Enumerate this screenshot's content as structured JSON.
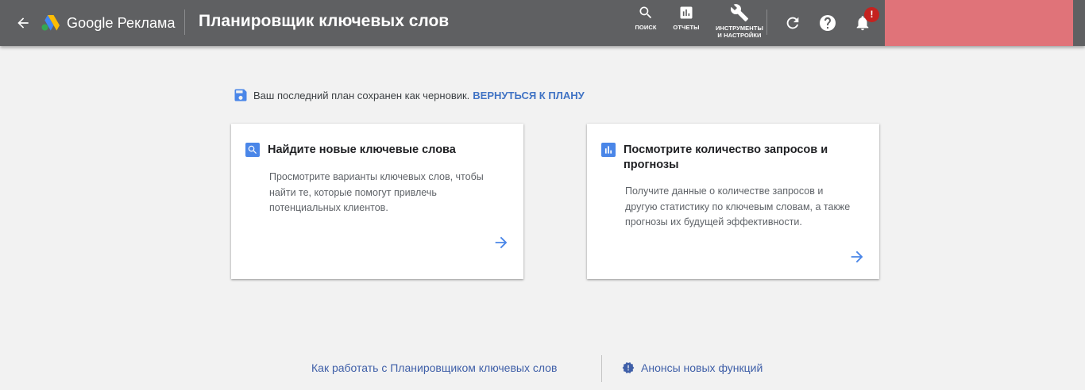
{
  "header": {
    "app_name": "Google Реклама",
    "page_title": "Планировщик ключевых слов",
    "tools": [
      {
        "label": "ПОИСК",
        "icon": "search-icon"
      },
      {
        "label": "ОТЧЕТЫ",
        "icon": "bar-chart-icon"
      },
      {
        "label_line1": "ИНСТРУМЕНТЫ",
        "label_line2": "И НАСТРОЙКИ",
        "icon": "wrench-icon"
      }
    ],
    "notification_badge": "!",
    "colors": {
      "bar": "#5f6062",
      "account_block": "#e07379",
      "badge": "#c5221f"
    }
  },
  "notice": {
    "text": "Ваш последний план сохранен как черновик.",
    "link": "ВЕРНУТЬСЯ К ПЛАНУ",
    "icon": "save-icon"
  },
  "cards": [
    {
      "title": "Найдите новые ключевые слова",
      "body_lines": [
        "Просмотрите варианты ключевых слов, чтобы",
        "найти те, которые помогут привлечь",
        "потенциальных клиентов."
      ],
      "icon": "search-icon"
    },
    {
      "title_line1": "Посмотрите количество запросов и",
      "title_line2": "прогнозы",
      "body_lines": [
        "Получите данные о количестве запросов и",
        "другую статистику по ключевым словам, а также",
        "прогнозы их будущей эффективности."
      ],
      "icon": "bar-chart-icon"
    }
  ],
  "footer": {
    "howto_link": "Как работать с Планировщиком ключевых слов",
    "news_link": "Анонсы новых функций"
  },
  "accent_color": "#4a86e8"
}
